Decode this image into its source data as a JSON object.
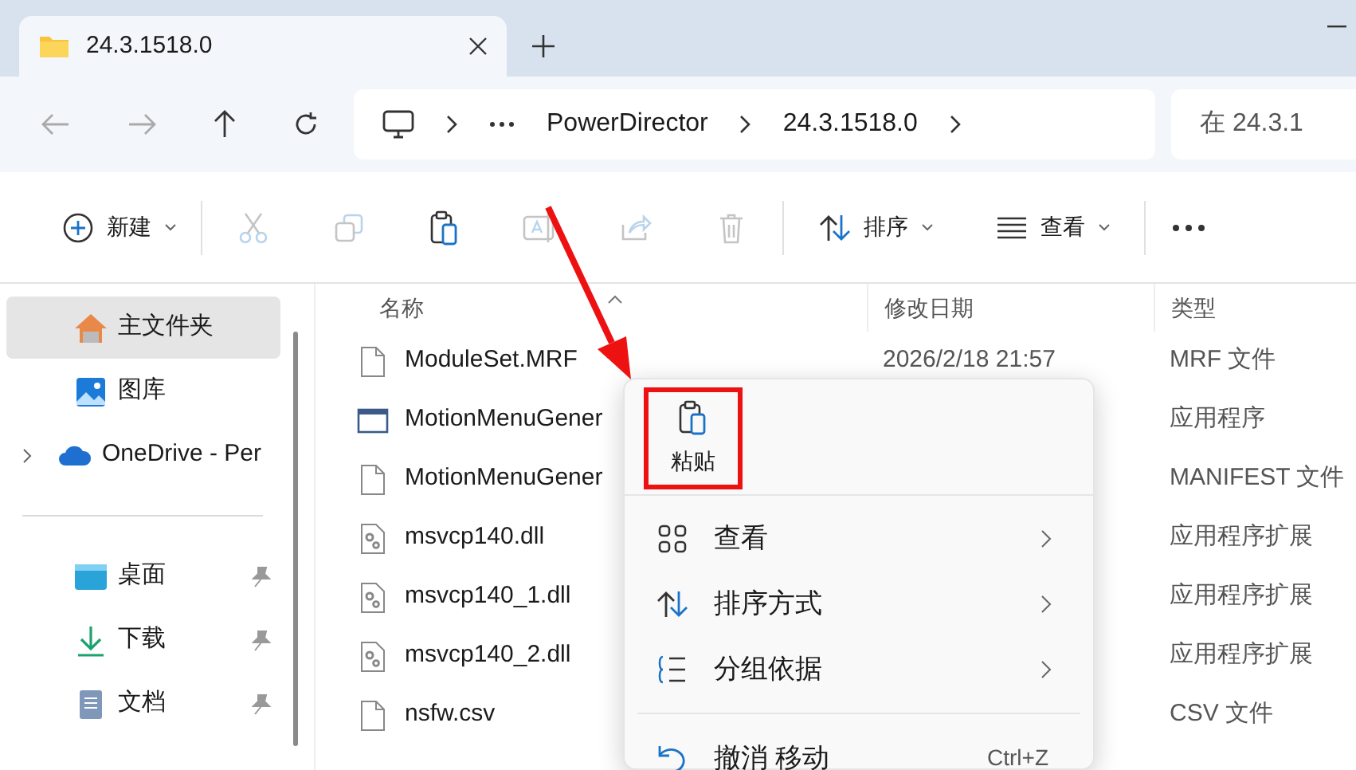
{
  "tab": {
    "title": "24.3.1518.0"
  },
  "breadcrumb": {
    "items": [
      "PowerDirector",
      "24.3.1518.0"
    ]
  },
  "search": {
    "placeholder": "在 24.3.1"
  },
  "commands": [
    {
      "kind": "new",
      "label": "新建",
      "disabled": false
    },
    {
      "kind": "cut",
      "disabled": true
    },
    {
      "kind": "copy",
      "disabled": true
    },
    {
      "kind": "paste",
      "disabled": false
    },
    {
      "kind": "rename",
      "disabled": true
    },
    {
      "kind": "share",
      "disabled": true
    },
    {
      "kind": "delete",
      "disabled": true
    },
    {
      "kind": "sort",
      "label": "排序",
      "disabled": false
    },
    {
      "kind": "view",
      "label": "查看",
      "disabled": false
    },
    {
      "kind": "more",
      "disabled": false
    }
  ],
  "sidebar": {
    "items": [
      {
        "kind": "home",
        "label": "主文件夹",
        "selected": true
      },
      {
        "kind": "gallery",
        "label": "图库",
        "selected": false
      },
      {
        "kind": "onedrive",
        "label": "OneDrive - Per",
        "selected": false
      }
    ],
    "pinned": [
      {
        "kind": "desktop",
        "label": "桌面",
        "selected": false
      },
      {
        "kind": "download",
        "label": "下载",
        "selected": false
      },
      {
        "kind": "documents",
        "label": "文档",
        "selected": false
      }
    ]
  },
  "table": {
    "columns": [
      "名称",
      "修改日期",
      "类型"
    ],
    "rows": [
      {
        "kind": "file",
        "name": "ModuleSet.MRF",
        "date": "2026/2/18 21:57",
        "type": "MRF 文件"
      },
      {
        "kind": "app",
        "name": "MotionMenuGener",
        "type": "应用程序"
      },
      {
        "kind": "file",
        "name": "MotionMenuGener",
        "type": "MANIFEST 文件"
      },
      {
        "kind": "dll",
        "name": "msvcp140.dll",
        "type": "应用程序扩展"
      },
      {
        "kind": "dll",
        "name": "msvcp140_1.dll",
        "type": "应用程序扩展"
      },
      {
        "kind": "dll",
        "name": "msvcp140_2.dll",
        "type": "应用程序扩展"
      },
      {
        "kind": "file",
        "name": "nsfw.csv",
        "type": "CSV 文件"
      }
    ]
  },
  "context_menu": {
    "paste": {
      "label": "粘贴",
      "highlighted": true
    },
    "items": [
      {
        "kind": "view",
        "label": "查看",
        "submenu": true
      },
      {
        "kind": "sort",
        "label": "排序方式",
        "submenu": true
      },
      {
        "kind": "group",
        "label": "分组依据",
        "submenu": true
      },
      {
        "kind": "undo",
        "label": "撤消 移动",
        "shortcut": "Ctrl+Z",
        "submenu": false
      }
    ]
  }
}
